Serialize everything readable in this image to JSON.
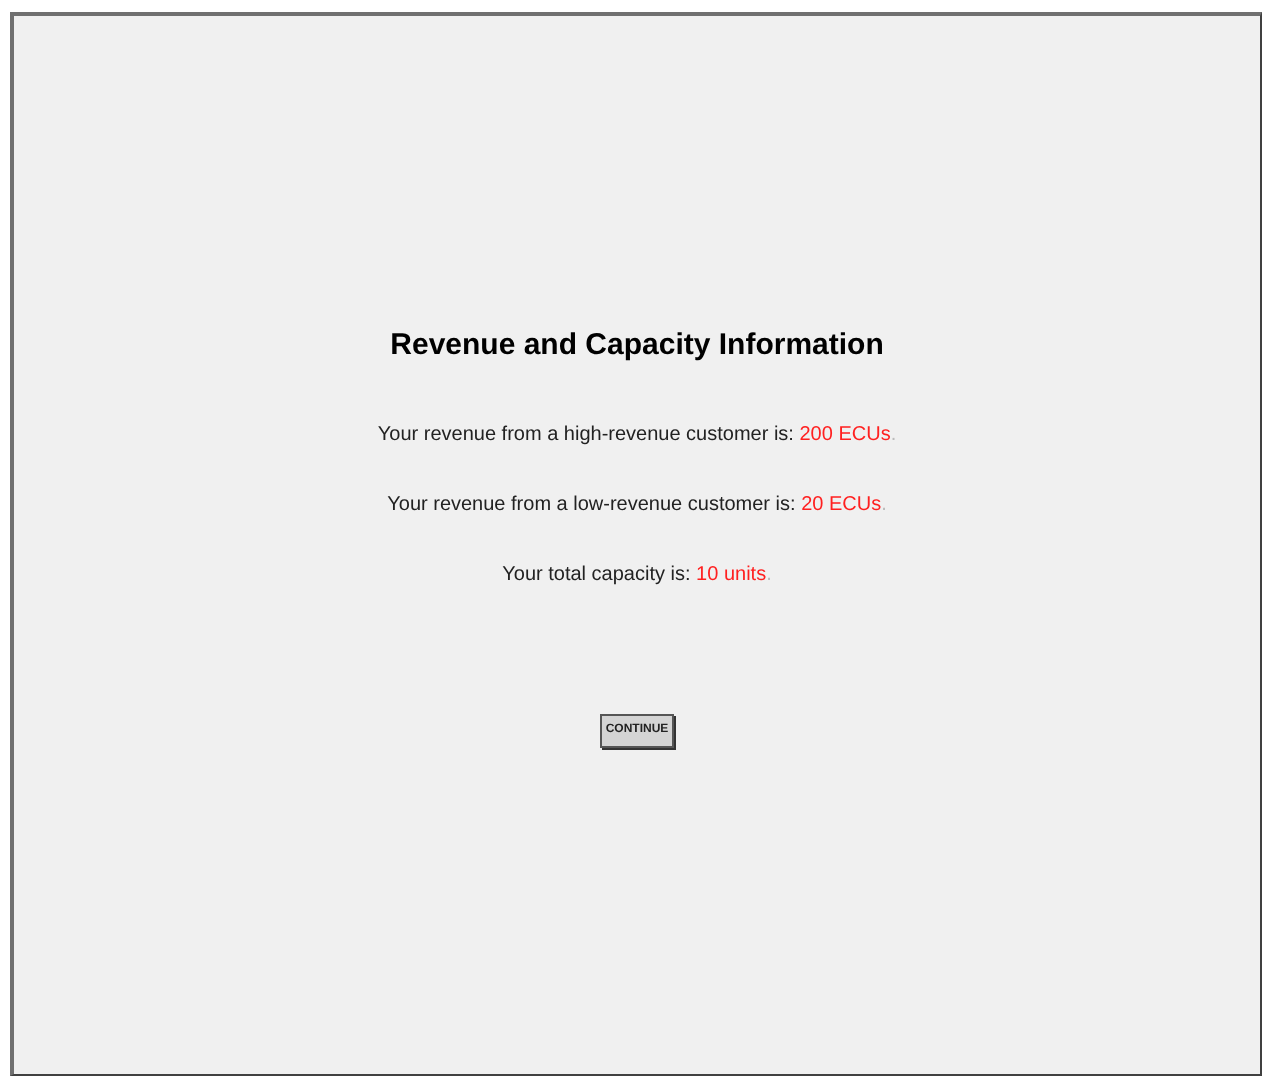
{
  "title": "Revenue and Capacity Information",
  "lines": [
    {
      "text": "Your revenue from a high-revenue customer is: ",
      "value": "200 ECUs",
      "end": "."
    },
    {
      "text": "Your revenue from a low-revenue customer is: ",
      "value": "20 ECUs",
      "end": "."
    },
    {
      "text": "Your total capacity is: ",
      "value": "10 units",
      "end": "."
    }
  ],
  "button": "CONTINUE"
}
